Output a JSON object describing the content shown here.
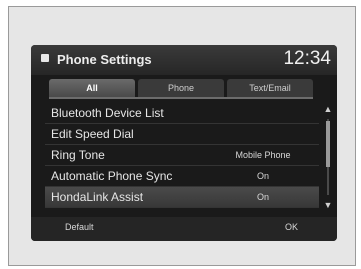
{
  "header": {
    "title": "Phone Settings",
    "clock": "12:34"
  },
  "tabs": [
    {
      "label": "All",
      "active": true
    },
    {
      "label": "Phone",
      "active": false
    },
    {
      "label": "Text/Email",
      "active": false
    }
  ],
  "list": {
    "items": [
      {
        "label": "Bluetooth Device List",
        "value": ""
      },
      {
        "label": "Edit Speed Dial",
        "value": ""
      },
      {
        "label": "Ring Tone",
        "value": "Mobile Phone"
      },
      {
        "label": "Automatic Phone Sync",
        "value": "On"
      },
      {
        "label": "HondaLink Assist",
        "value": "On",
        "selected": true
      }
    ]
  },
  "scroll": {
    "up_icon": "up-arrow-icon",
    "down_icon": "down-arrow-icon"
  },
  "footer": {
    "default_label": "Default",
    "ok_label": "OK"
  },
  "colors": {
    "screen_bg": "#1a1a1a",
    "text": "#e6e6e6",
    "selected_row": "#444444"
  }
}
